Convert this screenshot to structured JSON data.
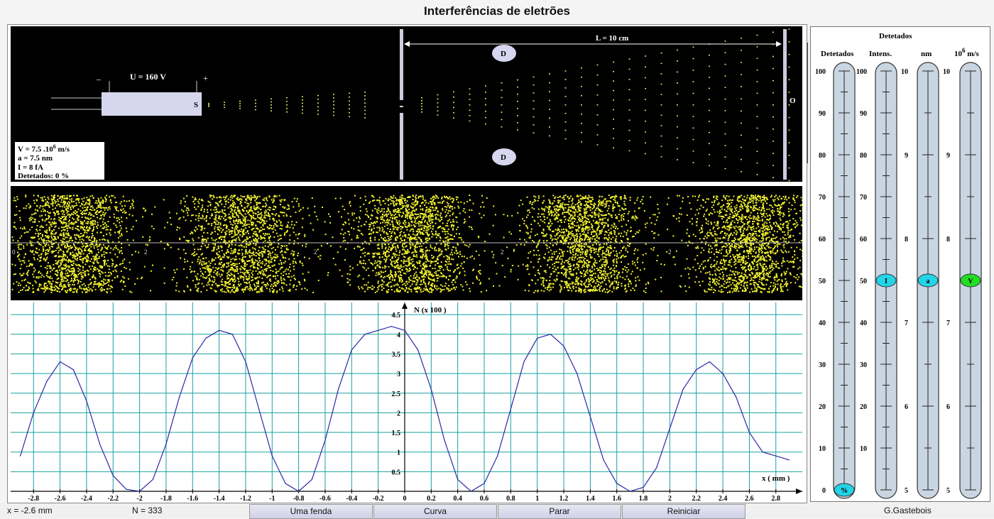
{
  "window": {
    "title": "Interferências de eletrões"
  },
  "apparatus": {
    "voltage_label": "U = 160 V",
    "minus": "–",
    "plus": "+",
    "source_label": "S",
    "distance_label": "L = 10 cm",
    "detector_label": "D",
    "origin_label": "O",
    "info": {
      "velocity_prefix": "V  = 7.5 .10",
      "velocity_exp": "6",
      "velocity_unit": " m/s",
      "slit_width": "a  = 7.5 nm",
      "intensity": "I  = 8 fA",
      "detected": "Detetados: 0 %"
    }
  },
  "screen": {
    "tick_labels": [
      "0",
      "2",
      "2",
      "2",
      "2"
    ]
  },
  "chart_data": {
    "type": "line",
    "title": "",
    "xlabel": "x ( mm )",
    "ylabel": "N (x 100 )",
    "xlim": [
      -2.95,
      2.95
    ],
    "ylim": [
      0,
      4.5
    ],
    "x_ticks": [
      "-2.8",
      "-2.6",
      "-2.4",
      "-2.2",
      "-2",
      "-1.8",
      "-1.6",
      "-1.4",
      "-1.2",
      "-1",
      "-0.8",
      "-0.6",
      "-0.4",
      "-0.2",
      "0",
      "0.2",
      "0.4",
      "0.6",
      "0.8",
      "1",
      "1.2",
      "1.4",
      "1.6",
      "1.8",
      "2",
      "2.2",
      "2.4",
      "2.6",
      "2.8"
    ],
    "y_ticks": [
      "0.5",
      "1",
      "1.5",
      "2",
      "2.5",
      "3",
      "3.5",
      "4",
      "4.5"
    ],
    "grid": true,
    "series": [
      {
        "color": "#2a2aa8",
        "x": [
          -2.9,
          -2.8,
          -2.7,
          -2.6,
          -2.5,
          -2.4,
          -2.3,
          -2.2,
          -2.1,
          -2.0,
          -1.9,
          -1.8,
          -1.7,
          -1.6,
          -1.5,
          -1.4,
          -1.3,
          -1.2,
          -1.1,
          -1.0,
          -0.9,
          -0.8,
          -0.7,
          -0.6,
          -0.5,
          -0.4,
          -0.3,
          -0.2,
          -0.1,
          0.0,
          0.1,
          0.2,
          0.3,
          0.4,
          0.5,
          0.6,
          0.7,
          0.8,
          0.9,
          1.0,
          1.1,
          1.2,
          1.3,
          1.4,
          1.5,
          1.6,
          1.7,
          1.8,
          1.9,
          2.0,
          2.1,
          2.2,
          2.3,
          2.4,
          2.5,
          2.6,
          2.7,
          2.8,
          2.9
        ],
        "y": [
          0.9,
          2.0,
          2.8,
          3.3,
          3.1,
          2.3,
          1.2,
          0.4,
          0.05,
          0.0,
          0.3,
          1.2,
          2.4,
          3.4,
          3.9,
          4.1,
          4.0,
          3.3,
          2.1,
          0.9,
          0.2,
          0.0,
          0.3,
          1.3,
          2.6,
          3.6,
          4.0,
          4.1,
          4.2,
          4.1,
          3.6,
          2.6,
          1.3,
          0.3,
          0.0,
          0.2,
          0.9,
          2.1,
          3.3,
          3.9,
          4.0,
          3.7,
          3.0,
          1.9,
          0.8,
          0.2,
          0.0,
          0.1,
          0.6,
          1.6,
          2.6,
          3.1,
          3.3,
          3.0,
          2.4,
          1.5,
          1.0,
          0.9,
          0.8
        ]
      }
    ]
  },
  "sidepanel": {
    "header": "Detetados",
    "columns": [
      {
        "label": "Detetados",
        "ticks": [
          "100",
          "90",
          "80",
          "70",
          "60",
          "50",
          "40",
          "30",
          "20",
          "10",
          "0"
        ],
        "knob": "%",
        "knob_color": "#22d4e6",
        "value": 0
      },
      {
        "label": "Intens.",
        "ticks": [
          "100",
          "90",
          "80",
          "70",
          "60",
          "50",
          "40",
          "30",
          "20",
          "10"
        ],
        "knob": "I",
        "knob_color": "#22d4e6",
        "value": 50
      },
      {
        "label": "nm",
        "ticks": [
          "10",
          "9",
          "8",
          "7",
          "6",
          "5"
        ],
        "knob": "a",
        "knob_color": "#22d4e6",
        "value": 7.5
      },
      {
        "label_prefix": "10",
        "label_exp": "6",
        "label_suffix": " m/s",
        "ticks": [
          "10",
          "9",
          "8",
          "7",
          "6",
          "5"
        ],
        "knob": "V",
        "knob_color": "#22dd22",
        "value": 7.5
      }
    ]
  },
  "statusbar": {
    "x_readout": "x = -2.6 mm",
    "n_readout": "N = 333",
    "buttons": {
      "one_slit": "Uma fenda",
      "curve": "Curva",
      "stop": "Parar",
      "restart": "Reiniciar"
    },
    "author": "G.Gastebois"
  }
}
